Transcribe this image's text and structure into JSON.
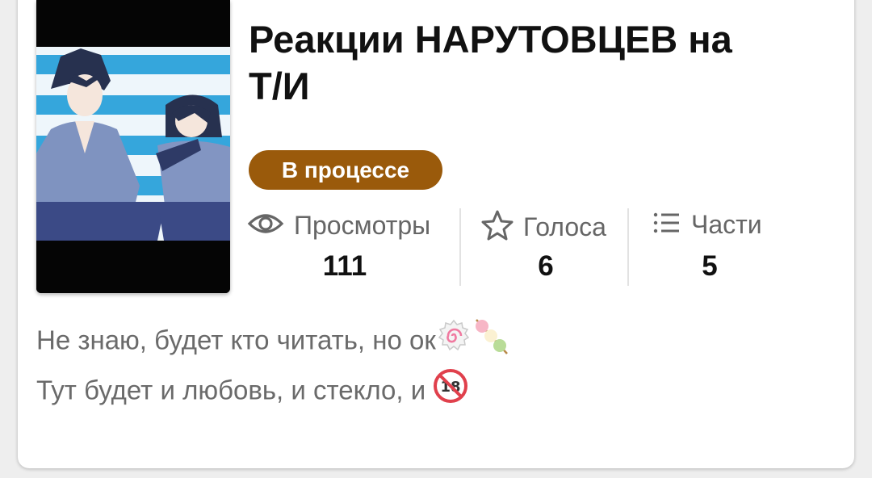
{
  "story": {
    "title_line1": "Реакции НАРУТОВЦЕВ на",
    "title_line2": "Т/И",
    "status": "В процессе",
    "status_color": "#9a5a0b",
    "stats": {
      "views_label": "Просмотры",
      "views_value": "111",
      "votes_label": "Голоса",
      "votes_value": "6",
      "parts_label": "Части",
      "parts_value": "5"
    },
    "description_line1": "Не знаю, будет кто читать, но ок",
    "description_line2": "Тут будет и любовь, и стекло, и",
    "emojis": [
      "fish-cake-emoji",
      "dango-emoji",
      "no-under-18-emoji"
    ]
  }
}
